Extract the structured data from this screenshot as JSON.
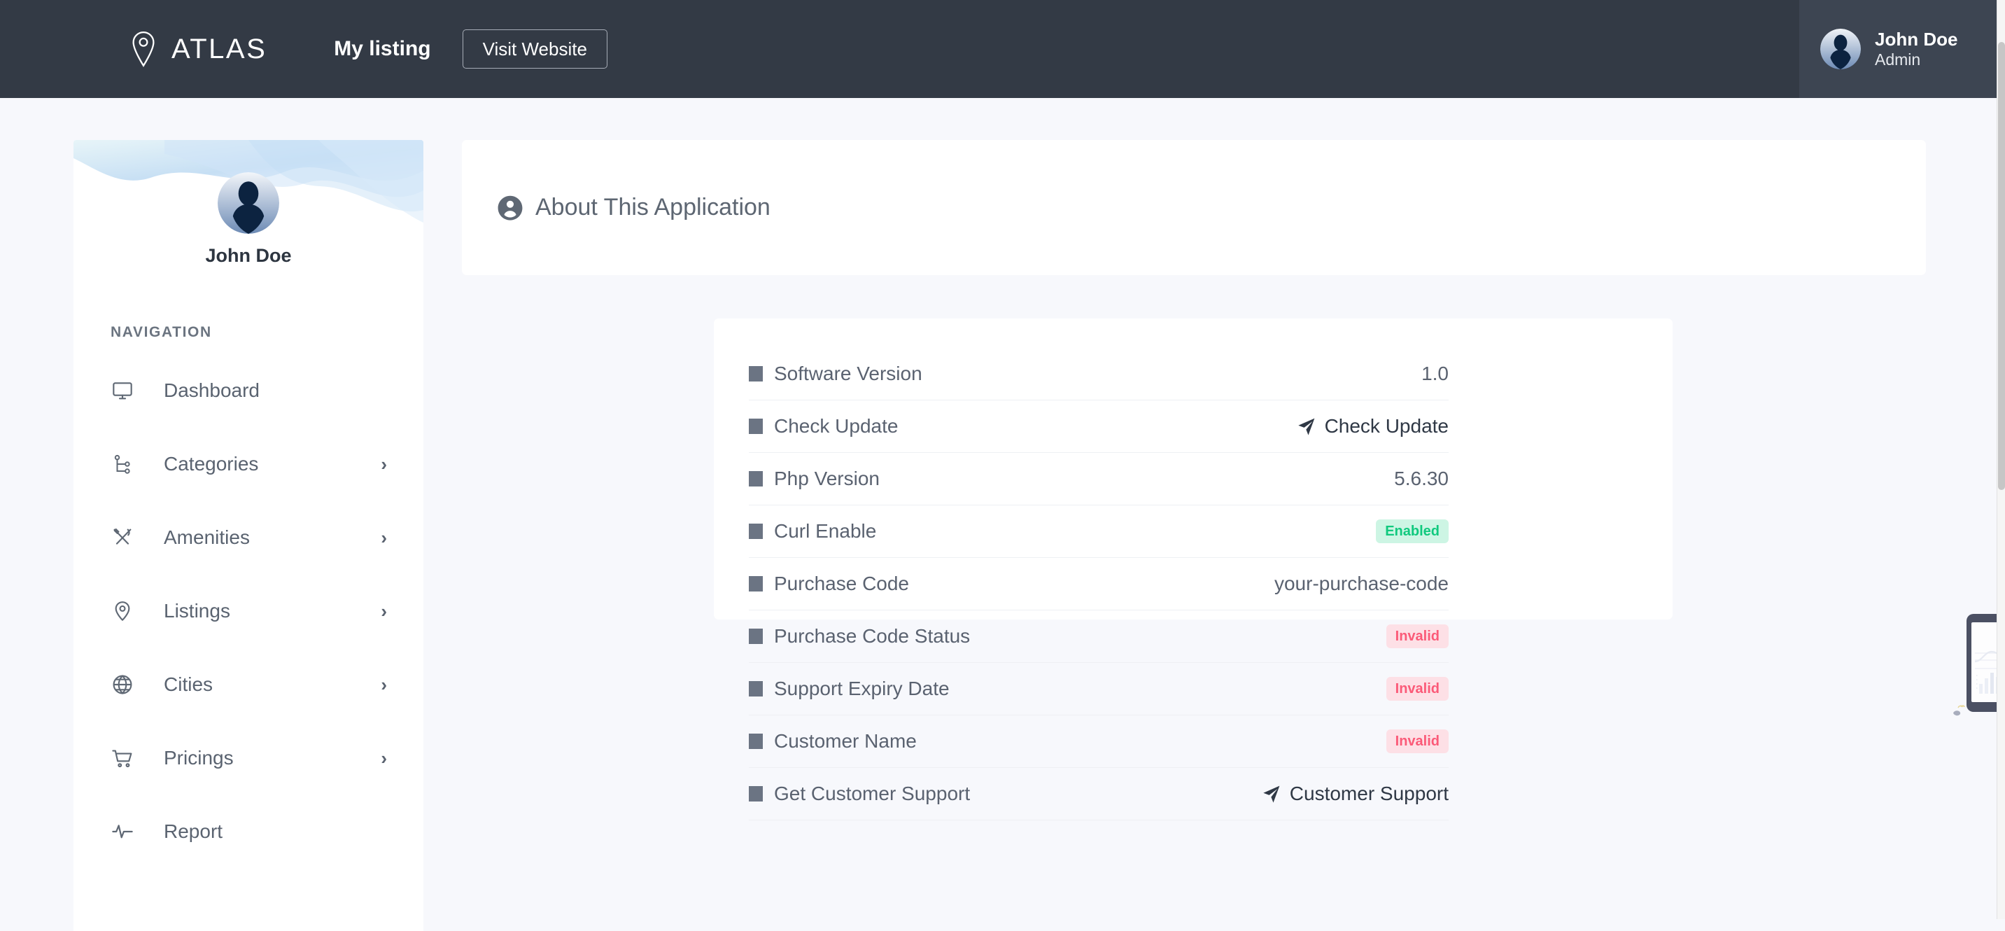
{
  "topbar": {
    "brand_name": "ATLAS",
    "brand_logo_icon": "map-pin-logo-icon",
    "my_listing_label": "My listing",
    "visit_website_label": "Visit Website",
    "user": {
      "avatar_icon": "user-avatar",
      "name": "John Doe",
      "role": "Admin"
    },
    "background_color": "#333a45",
    "user_box_color": "#3d4552"
  },
  "sidebar": {
    "profile": {
      "avatar_icon": "user-avatar",
      "name": "John Doe"
    },
    "nav_heading": "NAVIGATION",
    "items": [
      {
        "label": "Dashboard",
        "icon": "monitor-icon",
        "caret": "",
        "has_caret": false
      },
      {
        "label": "Categories",
        "icon": "sitemap-icon",
        "caret": "›",
        "has_caret": true
      },
      {
        "label": "Amenities",
        "icon": "cutlery-icon",
        "caret": "›",
        "has_caret": true
      },
      {
        "label": "Listings",
        "icon": "map-pin-icon",
        "caret": "›",
        "has_caret": true
      },
      {
        "label": "Cities",
        "icon": "globe-icon",
        "caret": "›",
        "has_caret": true
      },
      {
        "label": "Pricings",
        "icon": "shopping-cart-icon",
        "caret": "›",
        "has_caret": true
      },
      {
        "label": "Report",
        "icon": "activity-pulse-icon",
        "caret": "",
        "has_caret": false
      }
    ]
  },
  "main": {
    "about_card": {
      "icon": "user-circle-icon",
      "title": "About This Application"
    },
    "info_rows": [
      {
        "marker": "square-marker",
        "label": "Software Version",
        "value": "1.0",
        "value_type": "text"
      },
      {
        "marker": "square-marker",
        "label": "Check Update",
        "value": "Check Update",
        "value_type": "action",
        "action_icon": "send-icon"
      },
      {
        "marker": "square-marker",
        "label": "Php Version",
        "value": "5.6.30",
        "value_type": "text"
      },
      {
        "marker": "square-marker",
        "label": "Curl Enable",
        "value": "Enabled",
        "value_type": "badge-enabled"
      },
      {
        "marker": "square-marker",
        "label": "Purchase Code",
        "value": "your-purchase-code",
        "value_type": "text"
      },
      {
        "marker": "square-marker",
        "label": "Purchase Code Status",
        "value": "Invalid",
        "value_type": "badge-invalid"
      },
      {
        "marker": "square-marker",
        "label": "Support Expiry Date",
        "value": "Invalid",
        "value_type": "badge-invalid"
      },
      {
        "marker": "square-marker",
        "label": "Customer Name",
        "value": "Invalid",
        "value_type": "badge-invalid"
      },
      {
        "marker": "square-marker",
        "label": "Get Customer Support",
        "value": "Customer Support",
        "value_type": "action",
        "action_icon": "send-icon"
      }
    ],
    "illustration": "person-with-tablet-chart-illustration"
  },
  "colors": {
    "page_background": "#f7f8fc",
    "card_background": "#ffffff",
    "header_dark": "#333a45",
    "text_muted": "#5a6270",
    "badge_enabled_bg": "#cdf5e4",
    "badge_enabled_text": "#10c97e",
    "badge_invalid_bg": "#fde0e6",
    "badge_invalid_text": "#fb5a78"
  },
  "scrollbar": {
    "orientation": "vertical"
  }
}
